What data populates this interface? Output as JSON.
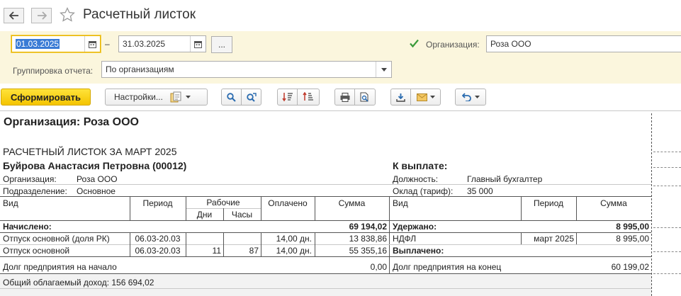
{
  "window": {
    "title": "Расчетный листок"
  },
  "filters": {
    "date_from": "01.03.2025",
    "date_separator": "–",
    "date_to": "31.03.2025",
    "dots_label": "...",
    "organization_label": "Организация:",
    "organization_value": "Роза ООО",
    "organization_checked": true,
    "grouping_label": "Группировка отчета:",
    "grouping_value": "По организациям"
  },
  "toolbar": {
    "generate_label": "Сформировать",
    "settings_label": "Настройки..."
  },
  "report": {
    "org_heading": "Организация: Роза ООО",
    "title": "РАСЧЕТНЫЙ ЛИСТОК ЗА МАРТ 2025",
    "employee": "Буйрова Анастасия Петровна (00012)",
    "to_pay_label": "К выплате:",
    "info_left": [
      {
        "label": "Организация:",
        "value": "Роза ООО"
      },
      {
        "label": "Подразделение:",
        "value": "Основное"
      }
    ],
    "info_right": [
      {
        "label": "Должность:",
        "value": "Главный бухгалтер"
      },
      {
        "label": "Оклад (тариф):",
        "value": "35 000"
      }
    ],
    "headers_left": {
      "kind": "Вид",
      "period": "Период",
      "working": "Рабочие",
      "days": "Дни",
      "hours": "Часы",
      "paid": "Оплачено",
      "sum": "Сумма"
    },
    "headers_right": {
      "kind": "Вид",
      "period": "Период",
      "sum": "Сумма"
    },
    "accrued_label": "Начислено:",
    "accrued_total": "69 194,02",
    "withheld_label": "Удержано:",
    "withheld_total": "8 995,00",
    "accrual_rows": [
      {
        "kind": "Отпуск основной (доля РК)",
        "period": "06.03-20.03",
        "days": "",
        "hours": "",
        "paid": "14,00 дн.",
        "sum": "13 838,86"
      },
      {
        "kind": "Отпуск основной",
        "period": "06.03-20.03",
        "days": "11",
        "hours": "87",
        "paid": "14,00 дн.",
        "sum": "55 355,16"
      }
    ],
    "withheld_rows": [
      {
        "kind": "НДФЛ",
        "period": "март 2025",
        "sum": "8 995,00"
      }
    ],
    "paid_out_label": "Выплачено:",
    "debt_start_label": "Долг предприятия на начало",
    "debt_start_value": "0,00",
    "debt_end_label": "Долг предприятия на конец",
    "debt_end_value": "60 199,02",
    "taxable_income": "Общий облагаемый доход: 156 694,02"
  },
  "colors": {
    "filter_bg": "#fbf6dd",
    "primary_button": "#f4c400",
    "selection": "#3a7bd5",
    "check": "#3a9a3a"
  }
}
